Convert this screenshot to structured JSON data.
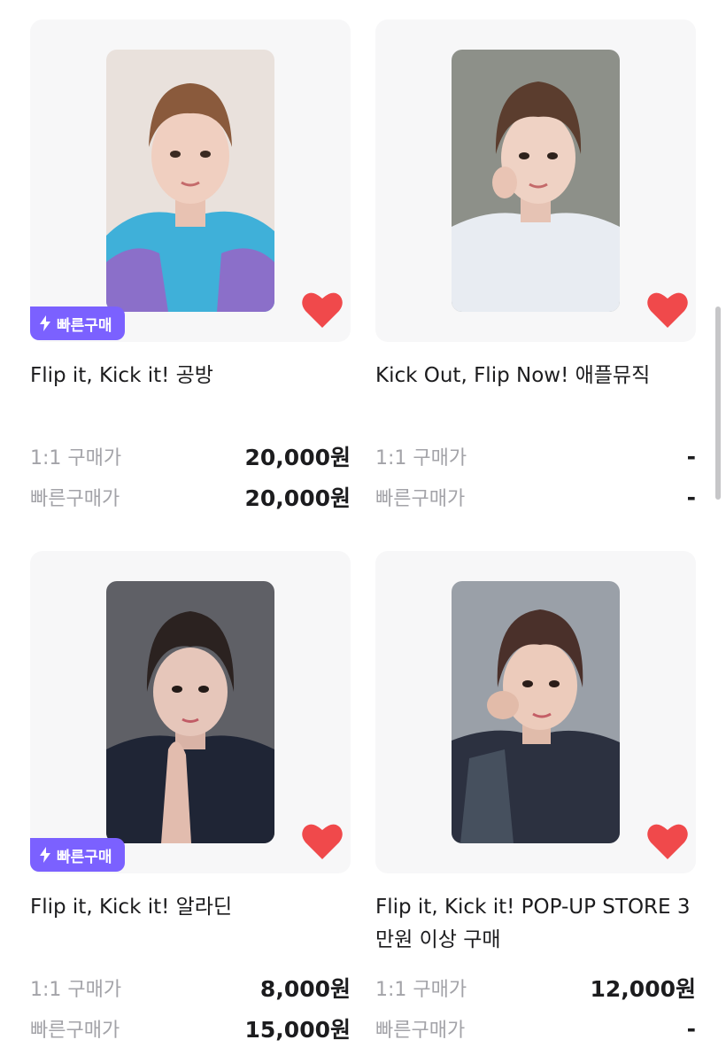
{
  "badge_label": "빠른구매",
  "colors": {
    "accent": "#7b61ff",
    "heart": "#f0494b",
    "label": "#a3a3a8"
  },
  "products": [
    {
      "title": "Flip it, Kick it! 공방",
      "fast_buy_badge": true,
      "liked": true,
      "prices": [
        {
          "label": "1:1 구매가",
          "value": "20,000원"
        },
        {
          "label": "빠른구매가",
          "value": "20,000원"
        }
      ]
    },
    {
      "title": "Kick Out, Flip Now! 애플뮤직",
      "fast_buy_badge": false,
      "liked": true,
      "prices": [
        {
          "label": "1:1 구매가",
          "value": "-"
        },
        {
          "label": "빠른구매가",
          "value": "-"
        }
      ]
    },
    {
      "title": "Flip it, Kick it! 알라딘",
      "fast_buy_badge": true,
      "liked": true,
      "prices": [
        {
          "label": "1:1 구매가",
          "value": "8,000원"
        },
        {
          "label": "빠른구매가",
          "value": "15,000원"
        }
      ]
    },
    {
      "title": "Flip it, Kick it! POP-UP STORE 3만원 이상 구매",
      "fast_buy_badge": false,
      "liked": true,
      "prices": [
        {
          "label": "1:1 구매가",
          "value": "12,000원"
        },
        {
          "label": "빠른구매가",
          "value": "-"
        }
      ]
    }
  ]
}
